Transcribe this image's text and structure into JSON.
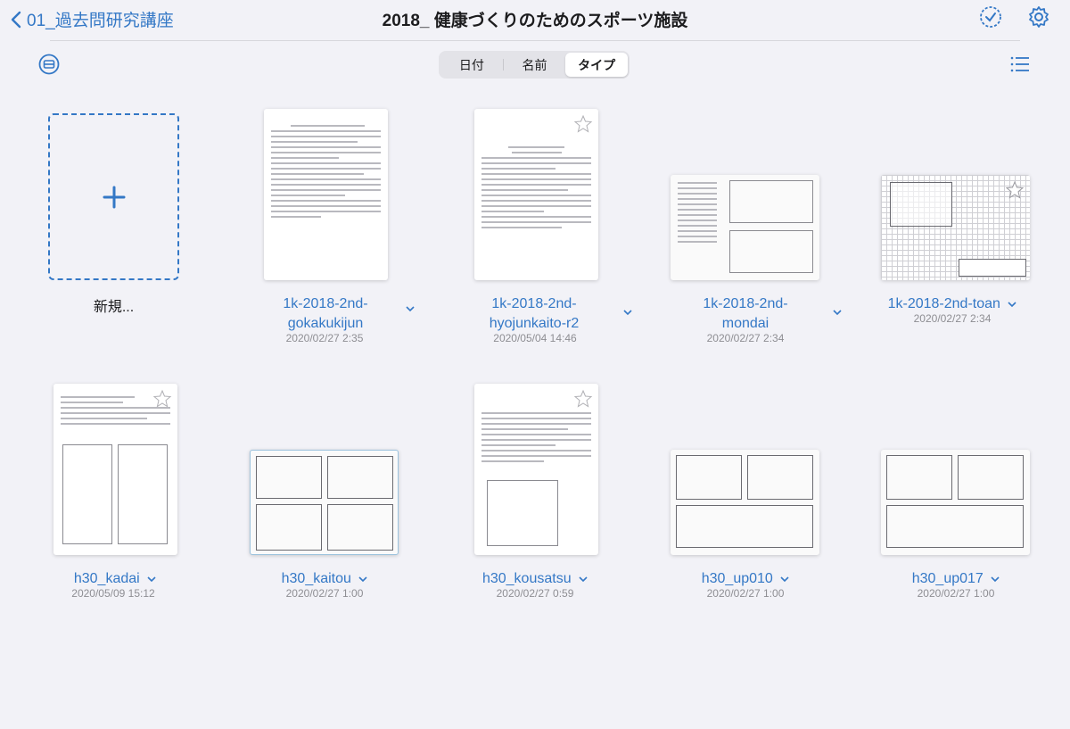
{
  "header": {
    "back_label": "01_過去問研究講座",
    "title": "2018_ 健康づくりのためのスポーツ施設"
  },
  "sort": {
    "options": [
      "日付",
      "名前",
      "タイプ"
    ],
    "selected": "タイプ"
  },
  "new_item": {
    "label": "新規..."
  },
  "files": [
    {
      "name_line1": "1k-2018-2nd-",
      "name_line2": "gokakukijun",
      "date": "2020/02/27 2:35"
    },
    {
      "name_line1": "1k-2018-2nd-",
      "name_line2": "hyojunkaito-r2",
      "date": "2020/05/04 14:46"
    },
    {
      "name_line1": "1k-2018-2nd-",
      "name_line2": "mondai",
      "date": "2020/02/27 2:34"
    },
    {
      "name_line1": "1k-2018-2nd-toan",
      "name_line2": "",
      "date": "2020/02/27 2:34"
    },
    {
      "name_line1": "h30_kadai",
      "name_line2": "",
      "date": "2020/05/09 15:12"
    },
    {
      "name_line1": "h30_kaitou",
      "name_line2": "",
      "date": "2020/02/27 1:00"
    },
    {
      "name_line1": "h30_kousatsu",
      "name_line2": "",
      "date": "2020/02/27 0:59"
    },
    {
      "name_line1": "h30_up010",
      "name_line2": "",
      "date": "2020/02/27 1:00"
    },
    {
      "name_line1": "h30_up017",
      "name_line2": "",
      "date": "2020/02/27 1:00"
    }
  ],
  "colors": {
    "accent": "#3478c6",
    "background": "#f2f2f7",
    "secondary_text": "#8e8e93"
  },
  "icons": [
    "chevron-left-icon",
    "select-circle-icon",
    "gear-icon",
    "collapse-icon",
    "plus-icon",
    "list-view-icon",
    "chevron-down-icon",
    "star-icon"
  ]
}
